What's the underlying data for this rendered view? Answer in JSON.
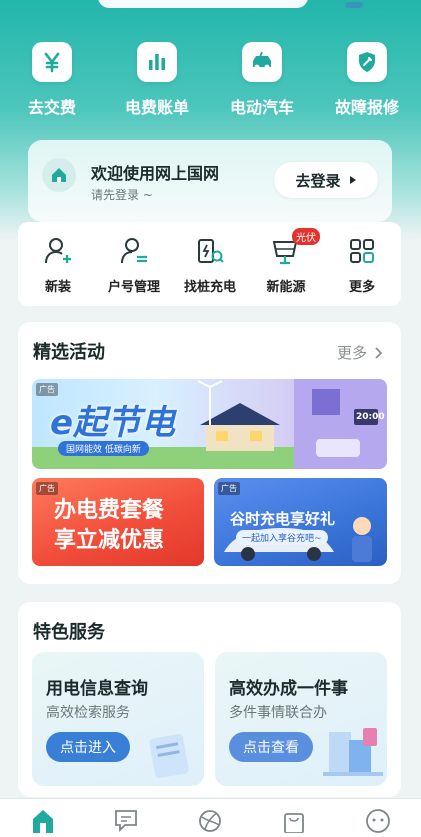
{
  "quick_actions": [
    {
      "label": "去交费",
      "icon": "yen-icon"
    },
    {
      "label": "电费账单",
      "icon": "bar-chart-icon"
    },
    {
      "label": "电动汽车",
      "icon": "ev-car-icon"
    },
    {
      "label": "故障报修",
      "icon": "repair-shield-icon"
    }
  ],
  "login": {
    "welcome": "欢迎使用网上国网",
    "subtitle": "请先登录 ~",
    "button": "去登录"
  },
  "services": [
    {
      "label": "新装",
      "icon": "user-add-icon"
    },
    {
      "label": "户号管理",
      "icon": "account-manage-icon"
    },
    {
      "label": "找桩充电",
      "icon": "charging-search-icon"
    },
    {
      "label": "新能源",
      "icon": "solar-panel-icon",
      "badge": "光伏"
    },
    {
      "label": "更多",
      "icon": "grid-icon"
    }
  ],
  "activities": {
    "title": "精选活动",
    "more": "更多",
    "ad_tag": "广告",
    "banner_main": {
      "headline": "e起节电",
      "slogan": "国网能效 低碳向新",
      "clock": "20:00"
    },
    "banner_left": {
      "line1": "办电费套餐",
      "line2": "享立减优惠"
    },
    "banner_right": {
      "line1": "谷时充电享好礼",
      "line2": "一起加入享谷充吧~"
    }
  },
  "features": {
    "title": "特色服务",
    "items": [
      {
        "title": "用电信息查询",
        "subtitle": "高效检索服务",
        "button": "点击进入"
      },
      {
        "title": "高效办成一件事",
        "subtitle": "多件事情联合办",
        "button": "点击查看"
      }
    ]
  },
  "bottom_nav": [
    "home-icon",
    "message-icon",
    "explore-icon",
    "bag-icon",
    "profile-icon"
  ],
  "colors": {
    "primary": "#23b6ab",
    "accent_blue": "#3a7fd6",
    "badge_red": "#e5322d"
  }
}
